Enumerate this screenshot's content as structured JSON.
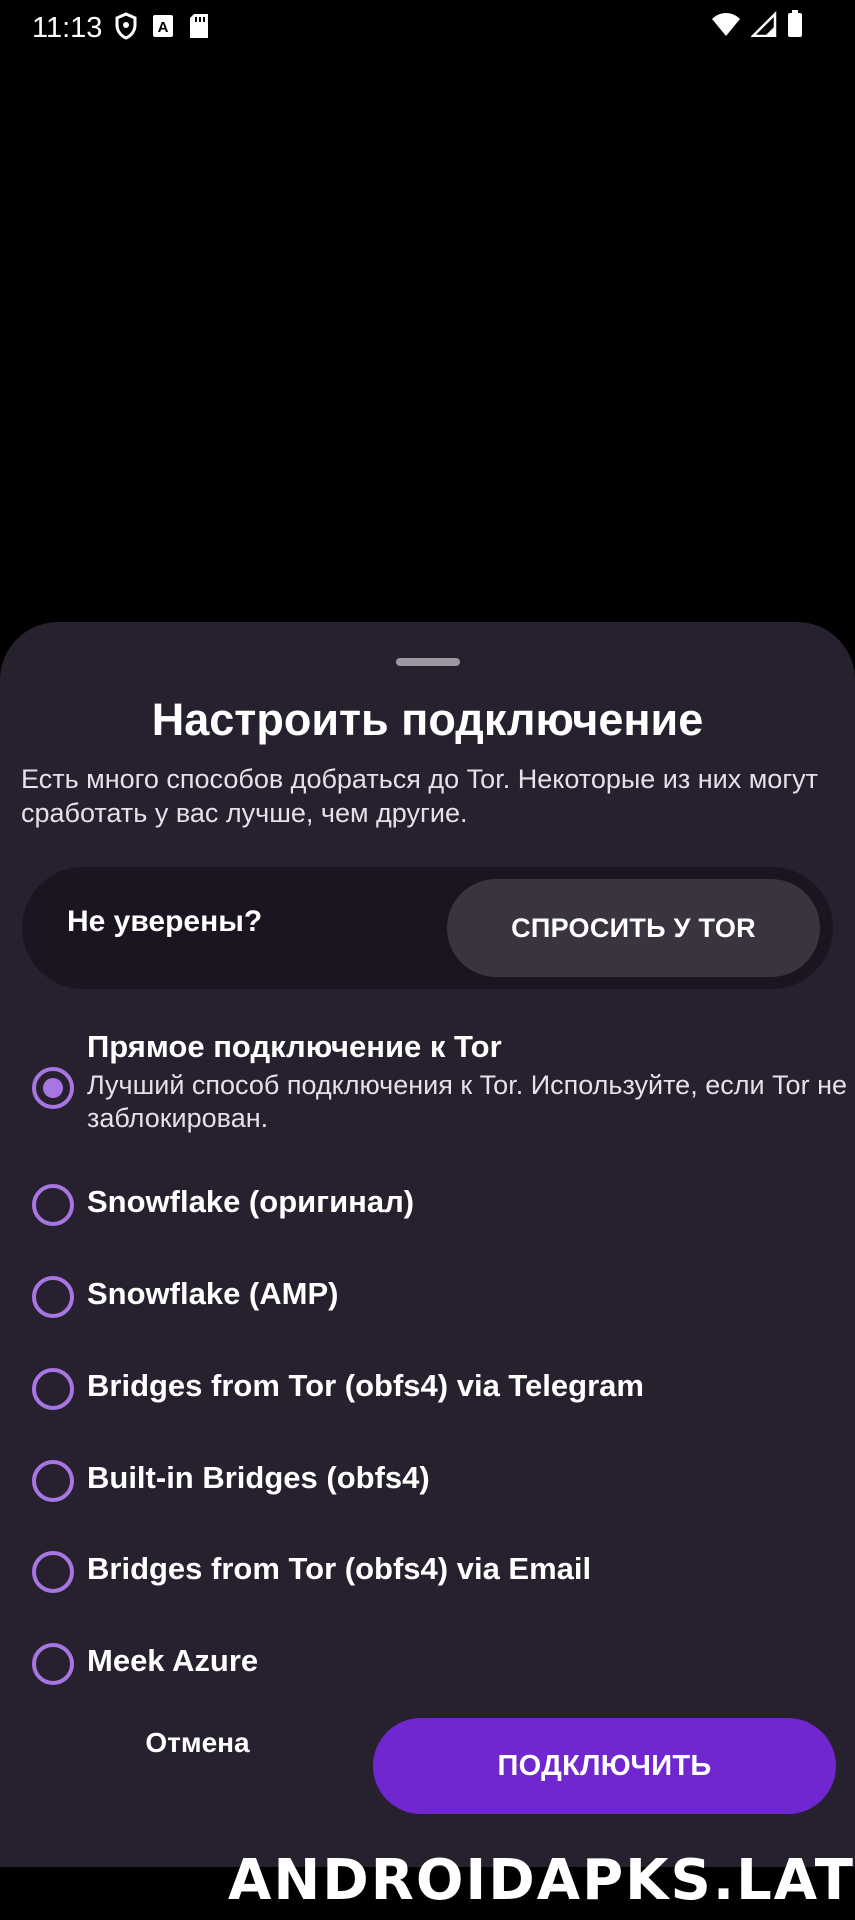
{
  "status_bar": {
    "time": "11:13",
    "left_icons": [
      "shield-icon",
      "font-a-icon",
      "sd-card-icon"
    ],
    "right_icons": [
      "wifi-icon",
      "signal-icon",
      "battery-icon"
    ]
  },
  "sheet": {
    "title": "Настроить подключение",
    "description": "Есть много способов добраться до Tor. Некоторые из них могут сработать у вас лучше, чем другие.",
    "ask": {
      "label": "Не уверены?",
      "button_label": "СПРОСИТЬ У TOR"
    },
    "options": [
      {
        "title": "Прямое подключение к Tor",
        "description": "Лучший способ подключения к Tor. Используйте, если Tor не заблокирован.",
        "selected": true
      },
      {
        "title": "Snowflake (оригинал)",
        "selected": false
      },
      {
        "title": "Snowflake (AMP)",
        "selected": false
      },
      {
        "title": "Bridges from Tor (obfs4) via Telegram",
        "selected": false
      },
      {
        "title": "Built-in Bridges (obfs4)",
        "selected": false
      },
      {
        "title": "Bridges from Tor (obfs4) via Email",
        "selected": false
      },
      {
        "title": "Meek Azure",
        "selected": false
      }
    ],
    "cancel_label": "Отмена",
    "connect_label": "ПОДКЛЮЧИТЬ"
  },
  "watermark": "ANDROIDAPKS.LAT",
  "colors": {
    "sheet_background": "#27212f",
    "ask_card_background": "#1a1520",
    "ask_button_background": "#3a3440",
    "radio_accent": "#a776e2",
    "primary_button": "#7027d0"
  }
}
